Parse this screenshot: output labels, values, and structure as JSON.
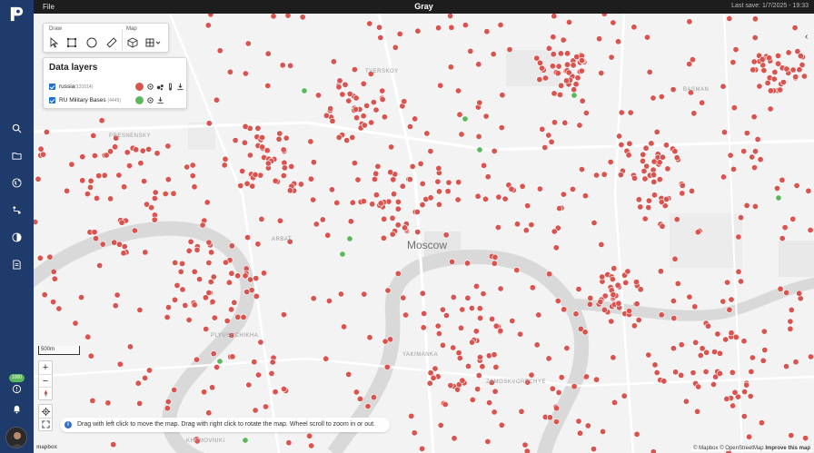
{
  "app": {
    "menu_file": "File",
    "title": "Gray",
    "last_save": "Last save: 1/7/2025 - 19:33"
  },
  "sidebar": {
    "items": [
      {
        "icon": "search-icon"
      },
      {
        "icon": "folder-icon"
      },
      {
        "icon": "globe-icon"
      },
      {
        "icon": "route-icon"
      },
      {
        "icon": "contrast-icon"
      },
      {
        "icon": "document-icon"
      }
    ],
    "notification_badge": "1000",
    "bottom_icons": [
      "alert-icon",
      "bell-icon"
    ]
  },
  "draw_toolbar": {
    "draw_label": "Draw",
    "map_label": "Map",
    "tools": [
      "pointer-icon",
      "rectangle-icon",
      "circle-icon",
      "ruler-icon"
    ],
    "map_tools": [
      "cube-icon",
      "grid-icon"
    ]
  },
  "layers": {
    "title": "Data layers",
    "rows": [
      {
        "name": "russia",
        "count": "(131014)",
        "color": "#d9534f"
      },
      {
        "name": "RU Military Bases",
        "count": "(4445)",
        "color": "#5cb85c"
      }
    ]
  },
  "map": {
    "city": "Moscow",
    "scale": "500m",
    "point_color": "#d9534f",
    "base_color": "#5cb85c",
    "labels": [
      "TVERSKOY",
      "BASMAN",
      "PRESNENSKY",
      "ARBAT",
      "PLYUSHCHIKHA",
      "ZAMOSKVORECHYE",
      "YAKIMANKA",
      "KHAMOVNIKI"
    ]
  },
  "hint": "Drag with left click to move the map. Drag with right click to rotate the map. Wheel scroll to zoom in or out.",
  "attribution": {
    "mapbox": "© Mapbox",
    "osm": "© OpenStreetMap",
    "improve": "Improve this map"
  },
  "logo_text": "mapbox"
}
